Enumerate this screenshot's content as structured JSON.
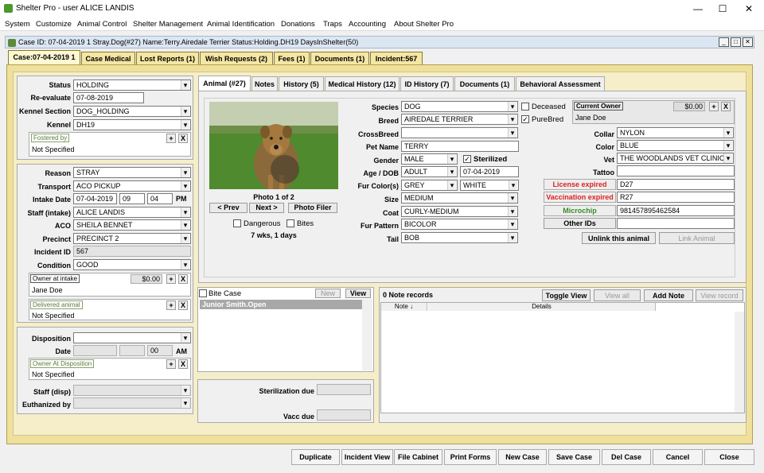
{
  "window": {
    "title": "Shelter Pro - user ALICE LANDIS",
    "min": "—",
    "max": "☐",
    "close": "✕"
  },
  "menu": [
    "System",
    "Customize",
    "Animal Control",
    "Shelter Management",
    "Animal Identification",
    "Donations",
    "Traps",
    "Accounting",
    "About Shelter Pro"
  ],
  "casebar": {
    "text": "Case ID: 07-04-2019 1    Stray.Dog(#27)  Name:Terry.Airedale Terrier  Status:Holding.DH19  DaysInShelter(50)"
  },
  "tabs": [
    "Case:07-04-2019 1",
    "Case Medical",
    "Lost Reports (1)",
    "Wish Requests (2)",
    "Fees (1)",
    "Documents (1)",
    "Incident:567"
  ],
  "left": {
    "status_l": "Status",
    "status": "HOLDING",
    "reeval_l": "Re-evaluate",
    "reeval": "07-08-2019",
    "ksec_l": "Kennel Section",
    "ksec": "DOG_HOLDING",
    "kennel_l": "Kennel",
    "kennel": "DH19",
    "foster_h": "Fostered by",
    "foster": "Not Specified",
    "reason_l": "Reason",
    "reason": "STRAY",
    "transport_l": "Transport",
    "transport": "ACO PICKUP",
    "idate_l": "Intake Date",
    "idate": "07-04-2019",
    "ihour": "09",
    "imin": "04",
    "ampm": "PM",
    "staff_l": "Staff (intake)",
    "staff": "ALICE LANDIS",
    "aco_l": "ACO",
    "aco": "SHEILA BENNET",
    "precinct_l": "Precinct",
    "precinct": "PRECINCT 2",
    "incid_l": "Incident ID",
    "incid": "567",
    "cond_l": "Condition",
    "cond": "GOOD",
    "owner_h": "Owner at intake",
    "owner_amt": "$0.00",
    "owner": "Jane Doe",
    "deliv_h": "Delivered animal",
    "deliv": "Not Specified",
    "disp_l": "Disposition",
    "date_l": "Date",
    "dmin": "00",
    "dampm": "AM",
    "ownerdisp_h": "Owner At Disposition",
    "ownerdisp": "Not Specified",
    "staffdisp_l": "Staff (disp)",
    "euth_l": "Euthanized by",
    "plus": "+",
    "x": "X"
  },
  "atabs": [
    "Animal (#27)",
    "Notes",
    "History (5)",
    "Medical History (12)",
    "ID History (7)",
    "Documents (1)",
    "Behavioral Assessment"
  ],
  "photo": {
    "caption": "Photo 1 of 2",
    "prev": "< Prev",
    "next": "Next >",
    "filer": "Photo Filer",
    "dangerous": "Dangerous",
    "bites": "Bites",
    "age": "7 wks, 1 days"
  },
  "animal": {
    "species_l": "Species",
    "species": "DOG",
    "deceased": "Deceased",
    "breed_l": "Breed",
    "breed": "AIREDALE TERRIER",
    "purebred": "PureBred",
    "cross_l": "CrossBreed",
    "name_l": "Pet Name",
    "name": "TERRY",
    "gender_l": "Gender",
    "gender": "MALE",
    "sterilized": "Sterilized",
    "age_l": "Age / DOB",
    "age": "ADULT",
    "dob": "07-04-2019",
    "fur_l": "Fur Color(s)",
    "fur1": "GREY",
    "fur2": "WHITE",
    "size_l": "Size",
    "size": "MEDIUM",
    "coat_l": "Coat",
    "coat": "CURLY-MEDIUM",
    "pattern_l": "Fur Pattern",
    "pattern": "BICOLOR",
    "tail_l": "Tail",
    "tail": "BOB",
    "cur_owner_h": "Current Owner",
    "cur_owner_amt": "$0.00",
    "cur_owner": "Jane Doe",
    "collar_l": "Collar",
    "collar": "NYLON",
    "color_l": "Color",
    "color": "BLUE",
    "vet_l": "Vet",
    "vet": "THE WOODLANDS VET CLINIC",
    "tattoo_l": "Tattoo",
    "license_l": "License expired",
    "license": "D27",
    "vacc_l": "Vaccination expired",
    "vacc": "R27",
    "micro_l": "Microchip",
    "micro": "981457895462584",
    "other_l": "Other IDs",
    "unlink": "Unlink this animal",
    "link": "Link Animal"
  },
  "bite": {
    "label": "Bite Case",
    "new": "New",
    "view": "View",
    "row": "Junior Smith.Open"
  },
  "notes": {
    "count": "0 Note records",
    "toggle": "Toggle View",
    "viewall": "View all",
    "add": "Add Note",
    "viewrec": "View record",
    "col1": "Note",
    "col2": "Details"
  },
  "due": {
    "steril": "Sterilization due",
    "vacc": "Vacc due"
  },
  "bottom": [
    "Duplicate",
    "Incident View",
    "File Cabinet",
    "Print Forms",
    "New Case",
    "Save Case",
    "Del Case",
    "Cancel",
    "Close"
  ]
}
